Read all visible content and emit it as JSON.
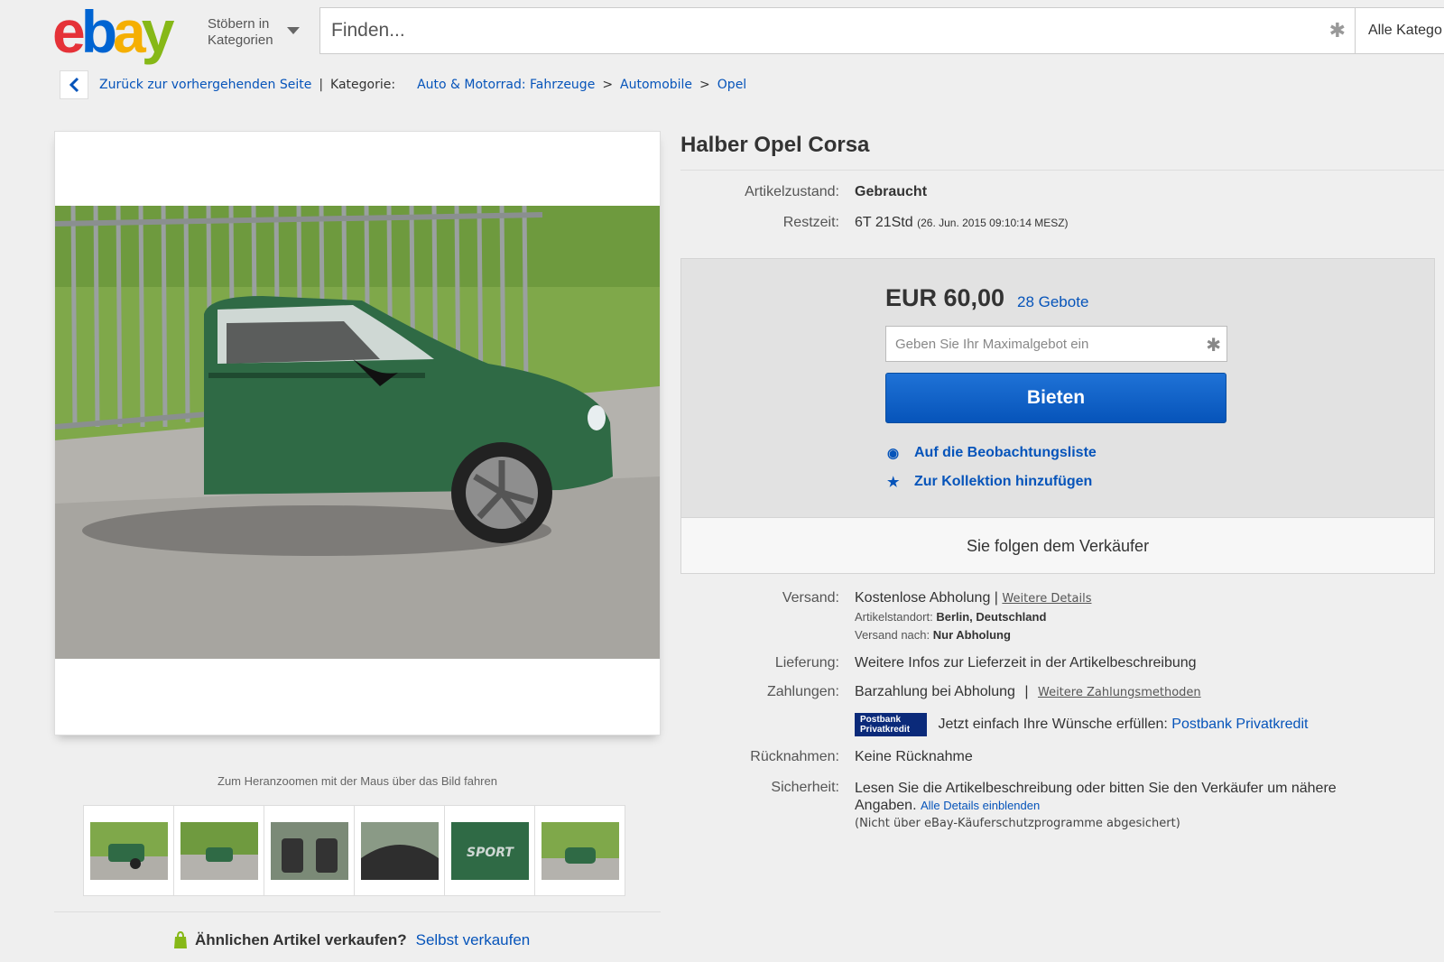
{
  "header": {
    "logo": [
      "e",
      "b",
      "a",
      "y"
    ],
    "browse_line1": "Stöbern in",
    "browse_line2": "Kategorien",
    "search_placeholder": "Finden...",
    "category_select": "Alle Katego"
  },
  "breadcrumb": {
    "back_label": "Zurück zur vorhergehenden Seite",
    "category_label": "Kategorie:",
    "items": [
      "Auto & Motorrad: Fahrzeuge",
      "Automobile",
      "Opel"
    ]
  },
  "gallery": {
    "zoom_hint": "Zum Heranzoomen mit der Maus über das Bild fahren",
    "thumbnails": [
      "car-side",
      "car-front-angle",
      "interior-seats",
      "interior-dash",
      "sport-badge",
      "car-front"
    ]
  },
  "sell": {
    "question": "Ähnlichen Artikel verkaufen?",
    "link": "Selbst verkaufen"
  },
  "item": {
    "title": "Halber Opel Corsa",
    "condition_label": "Artikelzustand:",
    "condition_value": "Gebraucht",
    "time_label": "Restzeit:",
    "time_value": "6T 21Std",
    "time_detail": "(26. Jun. 2015 09:10:14 MESZ)"
  },
  "bid": {
    "price": "EUR 60,00",
    "bids_count": "28 Gebote",
    "max_bid_placeholder": "Geben Sie Ihr Maximalgebot ein",
    "bid_button": "Bieten",
    "watch_link": "Auf die Beobachtungsliste",
    "collection_link": "Zur Kollektion hinzufügen",
    "follow_seller": "Sie folgen dem Verkäufer"
  },
  "details": {
    "shipping_label": "Versand:",
    "shipping_value": "Kostenlose Abholung",
    "shipping_sep": "|",
    "shipping_link": "Weitere Details",
    "location_label": "Artikelstandort:",
    "location_value": "Berlin, Deutschland",
    "ship_to_label": "Versand nach:",
    "ship_to_value": "Nur Abholung",
    "delivery_label": "Lieferung:",
    "delivery_value": "Weitere Infos zur Lieferzeit in der Artikelbeschreibung",
    "payment_label": "Zahlungen:",
    "payment_value": "Barzahlung bei Abholung",
    "payment_sep": "|",
    "payment_link": "Weitere Zahlungsmethoden",
    "postbank_logo_line1": "Postbank",
    "postbank_logo_line2": "Privatkredit",
    "postbank_text": "Jetzt einfach Ihre Wünsche erfüllen:",
    "postbank_link": "Postbank Privatkredit",
    "returns_label": "Rücknahmen:",
    "returns_value": "Keine Rücknahme",
    "security_label": "Sicherheit:",
    "security_value": "Lesen Sie die Artikelbeschreibung oder bitten Sie den Verkäufer um nähere Angaben.",
    "security_link": "Alle Details einblenden",
    "security_note": "(Nicht über eBay-Käuferschutzprogramme abgesichert)"
  }
}
